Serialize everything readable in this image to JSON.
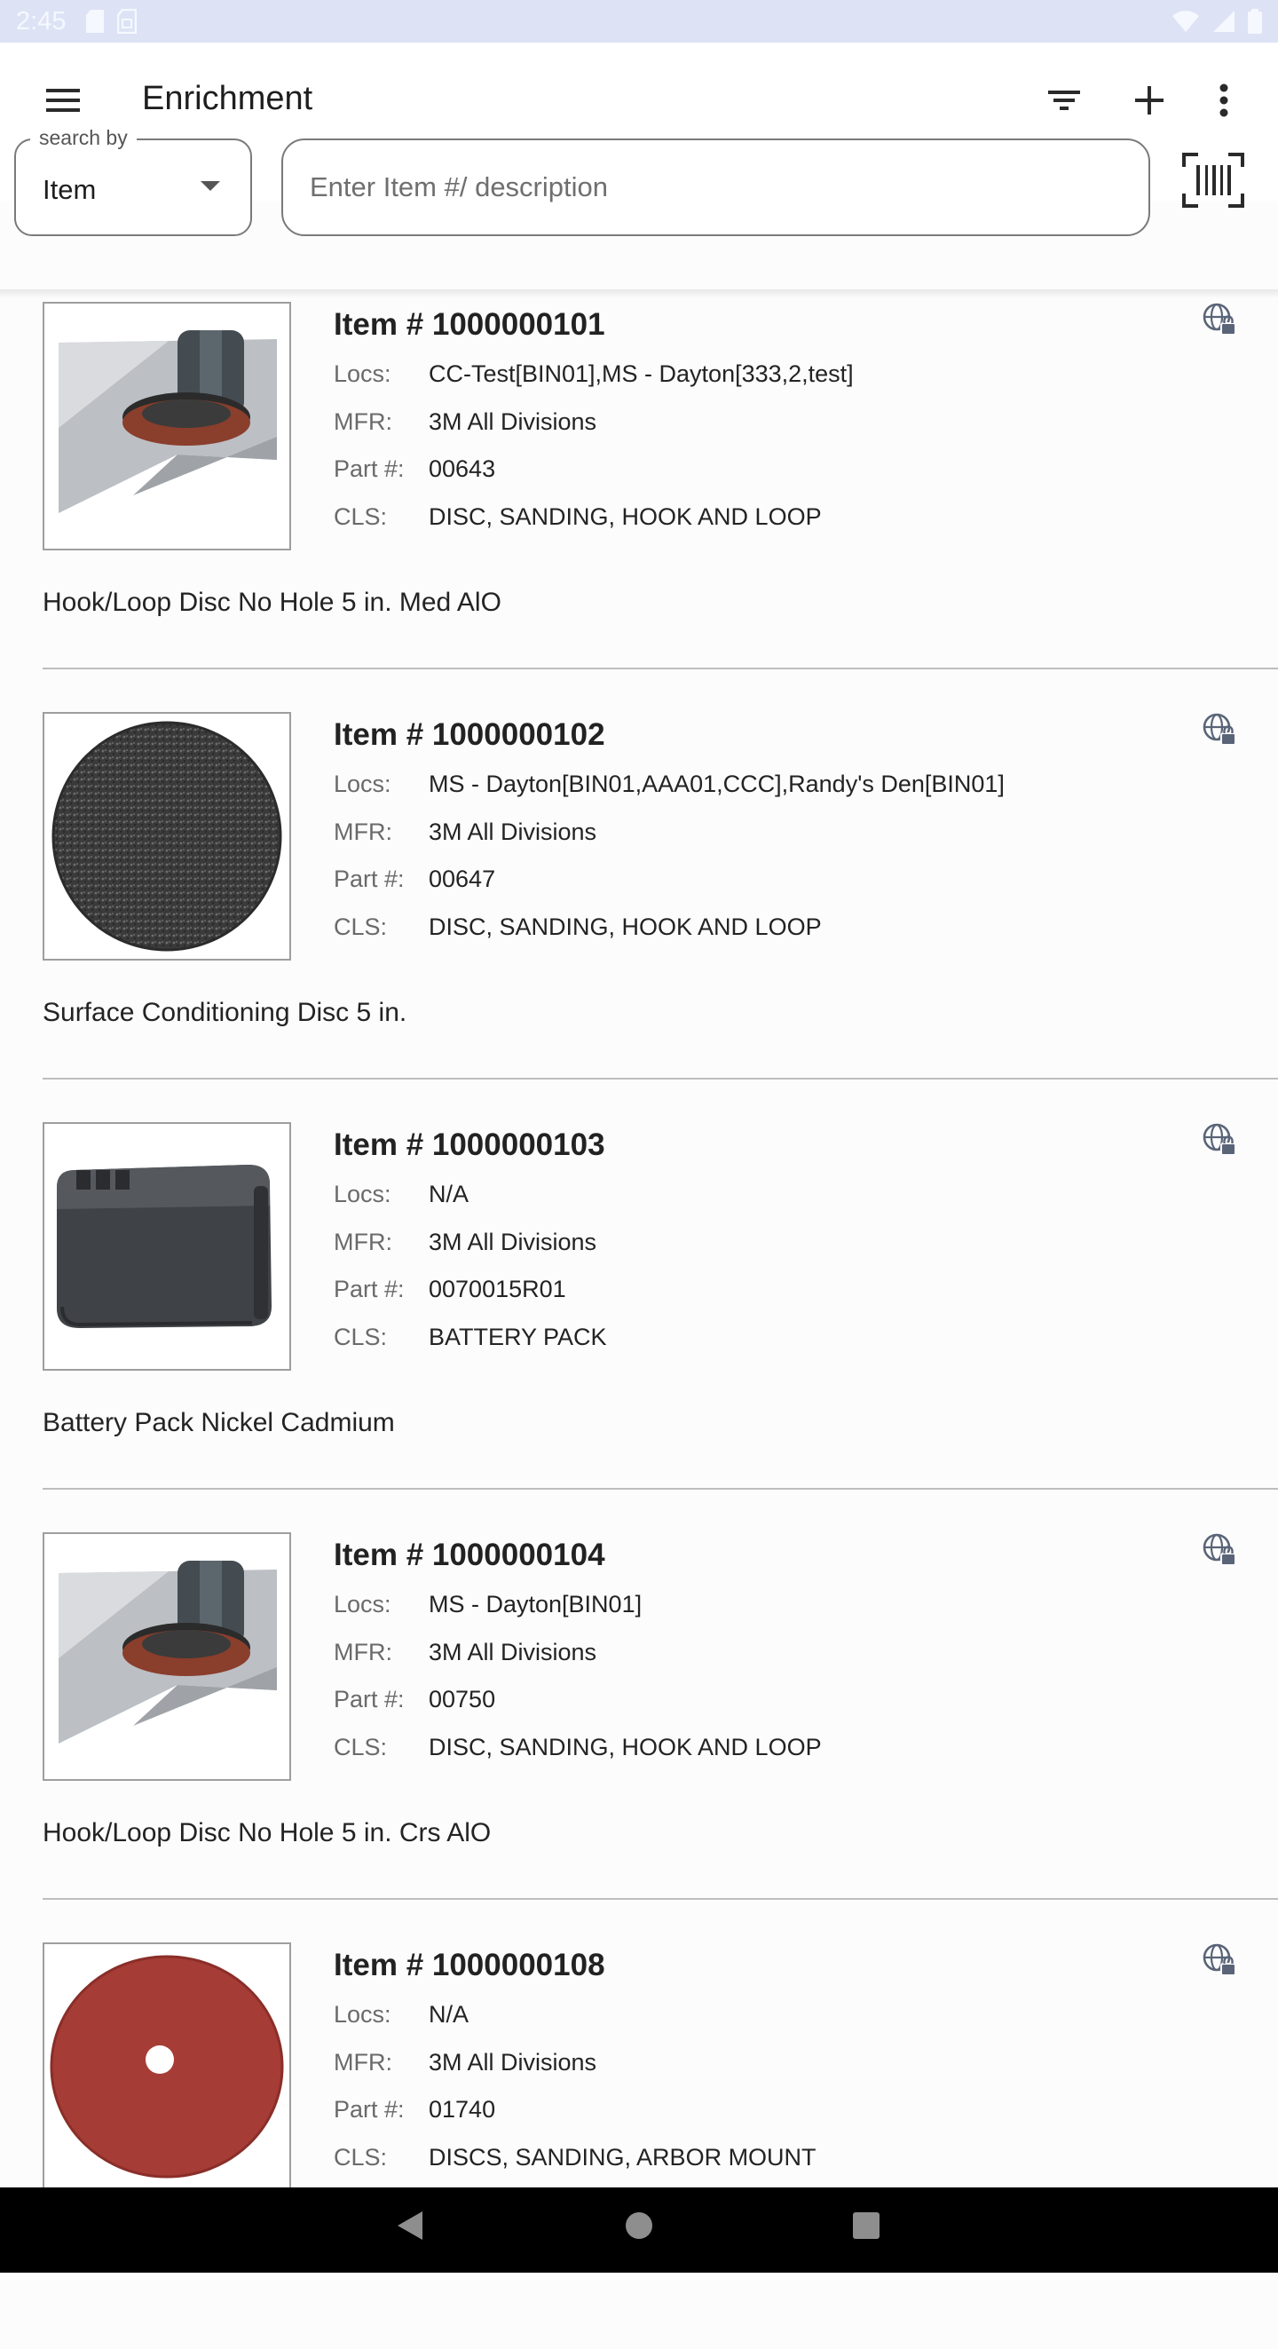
{
  "status_bar": {
    "time": "2:45"
  },
  "app_bar": {
    "title": "Enrichment",
    "search_by_label": "search by",
    "search_by_value": "Item",
    "search_placeholder": "Enter Item #/ description",
    "search_value": ""
  },
  "item_labels": {
    "locs": "Locs:",
    "mfr": "MFR:",
    "part": "Part #:",
    "cls": "CLS:"
  },
  "items": [
    {
      "title": "Item # 1000000101",
      "locs": "CC-Test[BIN01],MS - Dayton[333,2,test]",
      "mfr": "3M All Divisions",
      "part": "00643",
      "cls": "DISC, SANDING, HOOK AND LOOP",
      "description": "Hook/Loop Disc No Hole 5 in. Med AlO",
      "image": "sander-disc-photo"
    },
    {
      "title": "Item # 1000000102",
      "locs": "MS - Dayton[BIN01,AAA01,CCC],Randy's Den[BIN01]",
      "mfr": "3M All Divisions",
      "part": "00647",
      "cls": "DISC, SANDING, HOOK AND LOOP",
      "description": "Surface Conditioning Disc 5 in.",
      "image": "conditioning-disc-photo"
    },
    {
      "title": "Item # 1000000103",
      "locs": "N/A",
      "mfr": "3M All Divisions",
      "part": "0070015R01",
      "cls": "BATTERY PACK",
      "description": "Battery Pack Nickel Cadmium",
      "image": "battery-pack-photo"
    },
    {
      "title": "Item # 1000000104",
      "locs": "MS - Dayton[BIN01]",
      "mfr": "3M All Divisions",
      "part": "00750",
      "cls": "DISC, SANDING, HOOK AND LOOP",
      "description": "Hook/Loop Disc No Hole 5 in. Crs AlO",
      "image": "sander-disc-photo"
    },
    {
      "title": "Item # 1000000108",
      "locs": "N/A",
      "mfr": "3M All Divisions",
      "part": "01740",
      "cls": "DISCS, SANDING, ARBOR MOUNT",
      "description": "",
      "image": "arbor-disc-photo"
    }
  ],
  "icons": {
    "menu": "menu-icon",
    "filter": "filter-icon",
    "add": "add-icon",
    "more": "more-vert-icon",
    "barcode": "barcode-scan-icon",
    "globe_lock": "globe-lock-icon"
  },
  "colors": {
    "status_bar": "#dde3f5",
    "icon": "#2a2a2a",
    "globe_icon": "#5a6478",
    "nav_bar": "#000000"
  }
}
